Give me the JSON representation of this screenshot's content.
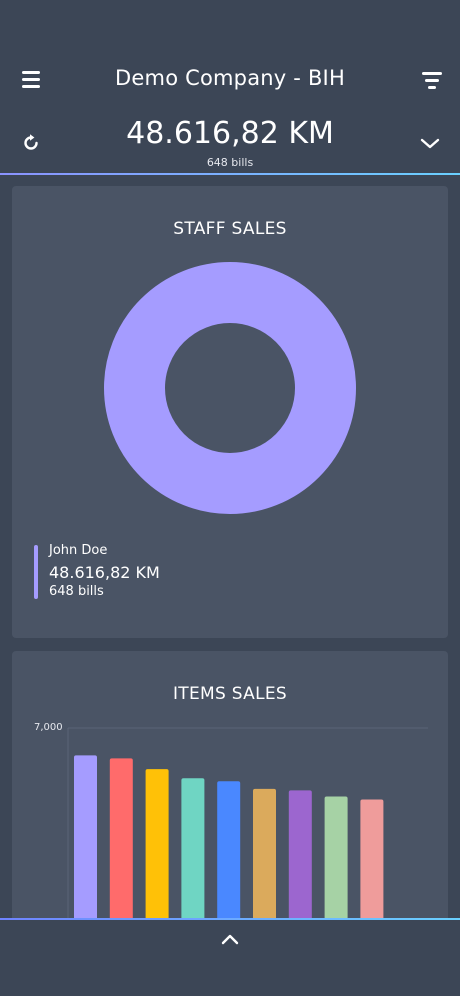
{
  "header": {
    "company": "Demo Company - BIH",
    "total": "48.616,82 KM",
    "bills": "648 bills"
  },
  "icons": {
    "menu": "menu-icon",
    "filter": "filter-icon",
    "refresh": "refresh-icon",
    "expand": "chevron-down-icon",
    "collapse": "chevron-up-icon"
  },
  "staff_sales": {
    "title": "STAFF SALES",
    "legend": {
      "name": "John Doe",
      "value": "48.616,82 KM",
      "bills": "648 bills"
    }
  },
  "items_sales": {
    "title": "ITEMS SALES",
    "y_tick": "7,000"
  },
  "colors": {
    "background": "#3c4656",
    "card": "#4a5465",
    "donut": "#a59cff",
    "accent_gradient_start": "#8b93ff",
    "accent_gradient_end": "#6ad0ff"
  },
  "chart_data": [
    {
      "type": "pie",
      "title": "STAFF SALES",
      "donut": true,
      "slices": [
        {
          "label": "John Doe",
          "value": 48616.82,
          "color": "#a59cff"
        }
      ]
    },
    {
      "type": "bar",
      "title": "ITEMS SALES",
      "ylim": [
        0,
        7000
      ],
      "y_ticks": [
        "7,000"
      ],
      "values": [
        6100,
        6000,
        5650,
        5350,
        5250,
        5000,
        4950,
        4750,
        4650
      ],
      "colors": [
        "#a59cff",
        "#ff6b6b",
        "#ffc107",
        "#6fd5c3",
        "#4a88ff",
        "#dbaa5c",
        "#9c66cf",
        "#a6d2a5",
        "#ef9c9b"
      ]
    }
  ]
}
